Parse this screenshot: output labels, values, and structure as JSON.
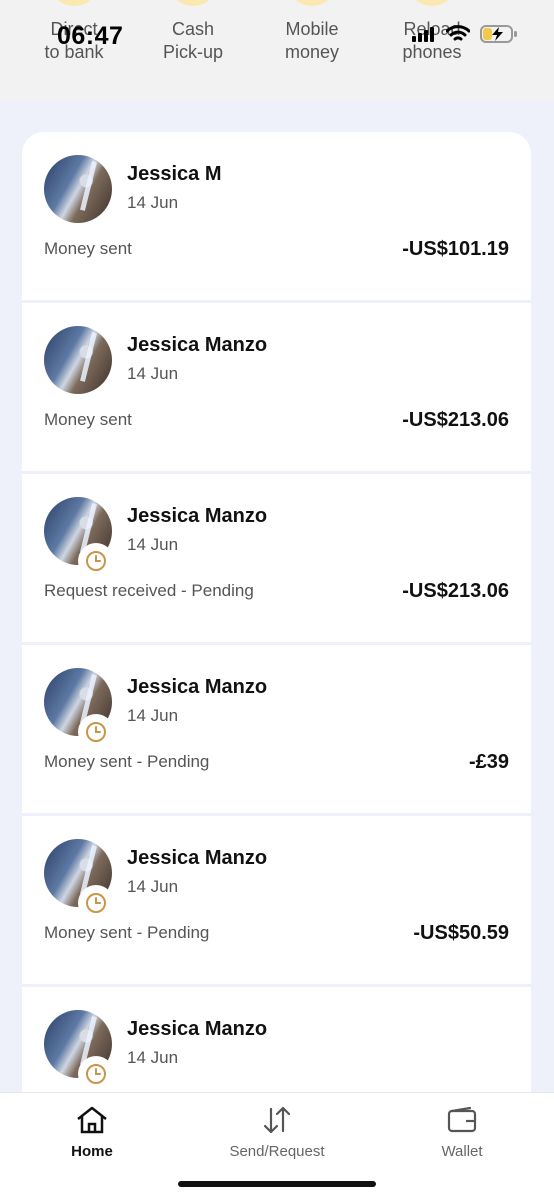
{
  "status_bar": {
    "time": "06:47"
  },
  "quick_actions": [
    {
      "label": "Direct\nto bank"
    },
    {
      "label": "Cash\nPick-up"
    },
    {
      "label": "Mobile\nmoney"
    },
    {
      "label": "Reload\nphones"
    }
  ],
  "transactions": [
    {
      "name": "Jessica M",
      "date": "14 Jun",
      "description": "Money sent",
      "amount": "-US$101.19",
      "pending": false
    },
    {
      "name": "Jessica Manzo",
      "date": "14 Jun",
      "description": "Money sent",
      "amount": "-US$213.06",
      "pending": false
    },
    {
      "name": "Jessica Manzo",
      "date": "14 Jun",
      "description": "Request received - Pending",
      "amount": "-US$213.06",
      "pending": true
    },
    {
      "name": "Jessica Manzo",
      "date": "14 Jun",
      "description": "Money sent - Pending",
      "amount": "-£39",
      "pending": true
    },
    {
      "name": "Jessica Manzo",
      "date": "14 Jun",
      "description": "Money sent - Pending",
      "amount": "-US$50.59",
      "pending": true
    },
    {
      "name": "Jessica Manzo",
      "date": "14 Jun",
      "description": "",
      "amount": "",
      "pending": true
    }
  ],
  "bottom_nav": [
    {
      "label": "Home",
      "icon": "home-icon",
      "active": true
    },
    {
      "label": "Send/Request",
      "icon": "transfer-arrows-icon",
      "active": false
    },
    {
      "label": "Wallet",
      "icon": "wallet-icon",
      "active": false
    }
  ],
  "colors": {
    "pending_clock": "#c8954a",
    "background": "#eef1f9"
  }
}
